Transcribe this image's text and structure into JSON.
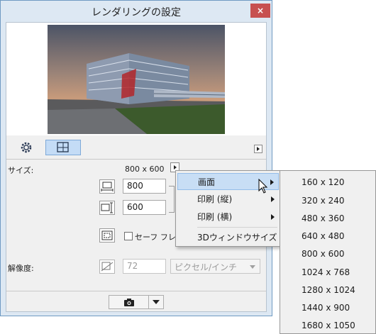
{
  "window": {
    "title": "レンダリングの設定",
    "close_glyph": "×"
  },
  "tabs": {
    "settings_icon": "gear-icon",
    "size_icon": "frame-size-icon",
    "more_arrow": "triangle-right"
  },
  "size": {
    "label": "サイズ:",
    "value": "800 x 600",
    "width_value": "800",
    "height_value": "600",
    "safe_frame_label": "セーフ フレー"
  },
  "resolution": {
    "label": "解像度:",
    "value": "72",
    "unit": "ピクセル/インチ"
  },
  "context_menu": {
    "items": [
      {
        "label": "画面",
        "submenu": true,
        "selected": true
      },
      {
        "label": "印刷 (縦)",
        "submenu": true,
        "selected": false
      },
      {
        "label": "印刷 (横)",
        "submenu": true,
        "selected": false
      },
      {
        "label": "3Dウィンドウサイズ",
        "submenu": false,
        "selected": false
      }
    ]
  },
  "submenu": {
    "items": [
      "160 x 120",
      "320 x 240",
      "480 x 360",
      "640 x 480",
      "800 x 600",
      "1024 x 768",
      "1280 x 1024",
      "1440 x 900",
      "1680 x 1050"
    ]
  },
  "colors": {
    "title_bar": "#dde8f3",
    "close_button": "#c75050",
    "selected_tab": "#c4dcf6",
    "menu_highlight": "#c8def5"
  }
}
